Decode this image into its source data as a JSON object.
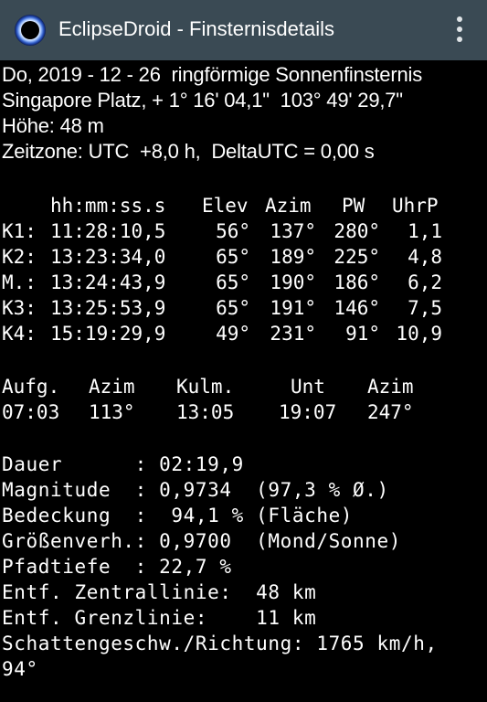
{
  "appbar": {
    "title": "EclipseDroid - Finsternisdetails",
    "app_icon": "eclipse-icon",
    "menu_icon": "overflow-menu-icon"
  },
  "header": {
    "line1": "Do, 2019 - 12 - 26  ringförmige Sonnenfinsternis",
    "line2": "Singapore Platz, + 1° 16' 04,1\"  103° 49' 29,7\"",
    "line3": "Höhe: 48 m",
    "line4": "Zeitzone: UTC  +8,0 h,  DeltaUTC = 0,00 s"
  },
  "contacts": {
    "columns": [
      "hh:mm:ss.s",
      "Elev",
      "Azim",
      "PW",
      "UhrP"
    ],
    "rows": [
      {
        "label": "K1:",
        "time": "11:28:10,5",
        "elev": "56°",
        "azim": "137°",
        "pw": "280°",
        "uhrp": "1,1"
      },
      {
        "label": "K2:",
        "time": "13:23:34,0",
        "elev": "65°",
        "azim": "189°",
        "pw": "225°",
        "uhrp": "4,8"
      },
      {
        "label": "M.:",
        "time": "13:24:43,9",
        "elev": "65°",
        "azim": "190°",
        "pw": "186°",
        "uhrp": "6,2"
      },
      {
        "label": "K3:",
        "time": "13:25:53,9",
        "elev": "65°",
        "azim": "191°",
        "pw": "146°",
        "uhrp": "7,5"
      },
      {
        "label": "K4:",
        "time": "15:19:29,9",
        "elev": "49°",
        "azim": "231°",
        "pw": "91°",
        "uhrp": "10,9"
      }
    ]
  },
  "sun": {
    "columns": [
      "Aufg.",
      "Azim",
      "Kulm.",
      "Unt",
      "Azim"
    ],
    "values": [
      "07:03",
      "113°",
      "13:05",
      "19:07",
      "247°"
    ]
  },
  "details": [
    "Dauer      : 02:19,9",
    "Magnitude  : 0,9734  (97,3 % Ø.)",
    "Bedeckung  :  94,1 % (Fläche)",
    "Größenverh.: 0,9700  (Mond/Sonne)",
    "Pfadtiefe  : 22,7 %",
    "Entf. Zentrallinie:  48 km",
    "Entf. Grenzlinie:    11 km",
    "Schattengeschw./Richtung: 1765 km/h,",
    "94°"
  ],
  "colors": {
    "appbar": "#3a4a54",
    "background": "#000000",
    "text": "#ffffff"
  }
}
